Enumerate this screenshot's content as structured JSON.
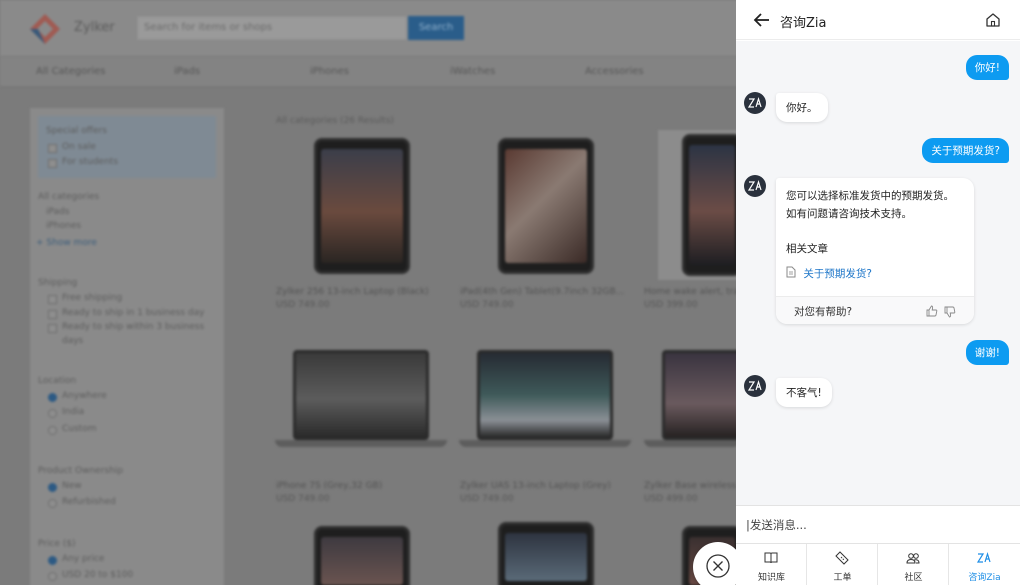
{
  "store": {
    "brand": "Zylker",
    "search_placeholder": "Search for items or shops",
    "search_button": "Search",
    "categories": [
      "All Categories",
      "iPads",
      "iPhones",
      "iWatches",
      "Accessories"
    ],
    "filters": {
      "special_title": "Special offers",
      "special_items": [
        "On sale",
        "For students"
      ],
      "all_categories_title": "All categories",
      "category_items": [
        "iPads",
        "iPhones"
      ],
      "show_more": "+ Show more",
      "shipping_title": "Shipping",
      "shipping_items": [
        "Free shipping",
        "Ready to ship in 1 business day",
        "Ready to ship within 3 business",
        "days"
      ],
      "location_title": "Location",
      "location_items": [
        "Anywhere",
        "India",
        "Custom"
      ],
      "ownership_title": "Product Ownership",
      "ownership_items": [
        "New",
        "Refurbished"
      ],
      "price_title": "Price ($)",
      "price_items": [
        "Any price",
        "USD 20 to $100"
      ]
    },
    "results_title": "All categories (26 Results)",
    "products": [
      {
        "title": "Zylker 256 13-inch Laptop (Black)",
        "price": "USD 749.00"
      },
      {
        "title": "iPad(4th Gen) Tablet(9.7inch 32GB...",
        "price": "USD 749.00"
      },
      {
        "title": "Home wake alert, tra...",
        "price": "USD 399.00"
      },
      {
        "title": "iPhone 7S (Grey,32 GB)",
        "price": "USD 749.00"
      },
      {
        "title": "Zylker UAS 13-inch Laptop (Grey)",
        "price": "USD 749.00"
      },
      {
        "title": "Zylker Base wireless...",
        "price": "USD 499.00"
      }
    ]
  },
  "chat": {
    "title": "咨询Zia",
    "messages": {
      "user_1": "你好!",
      "bot_1": "你好。",
      "user_2": "关于预期发货?",
      "bot_2_line1": "您可以选择标准发货中的预期发货。",
      "bot_2_line2": "如有问题请咨询技术支持。",
      "related_title": "相关文章",
      "related_link": "关于预期发货?",
      "feedback_prompt": "对您有帮助?",
      "user_3": "谢谢!",
      "bot_3": "不客气!"
    },
    "input_placeholder": "|发送消息...",
    "nav": [
      {
        "label": "知识库",
        "icon": "knowledge-base-icon"
      },
      {
        "label": "工单",
        "icon": "ticket-icon"
      },
      {
        "label": "社区",
        "icon": "community-icon"
      },
      {
        "label": "咨询Zia",
        "icon": "zia-icon"
      }
    ],
    "accent": "#0d9bf1"
  }
}
